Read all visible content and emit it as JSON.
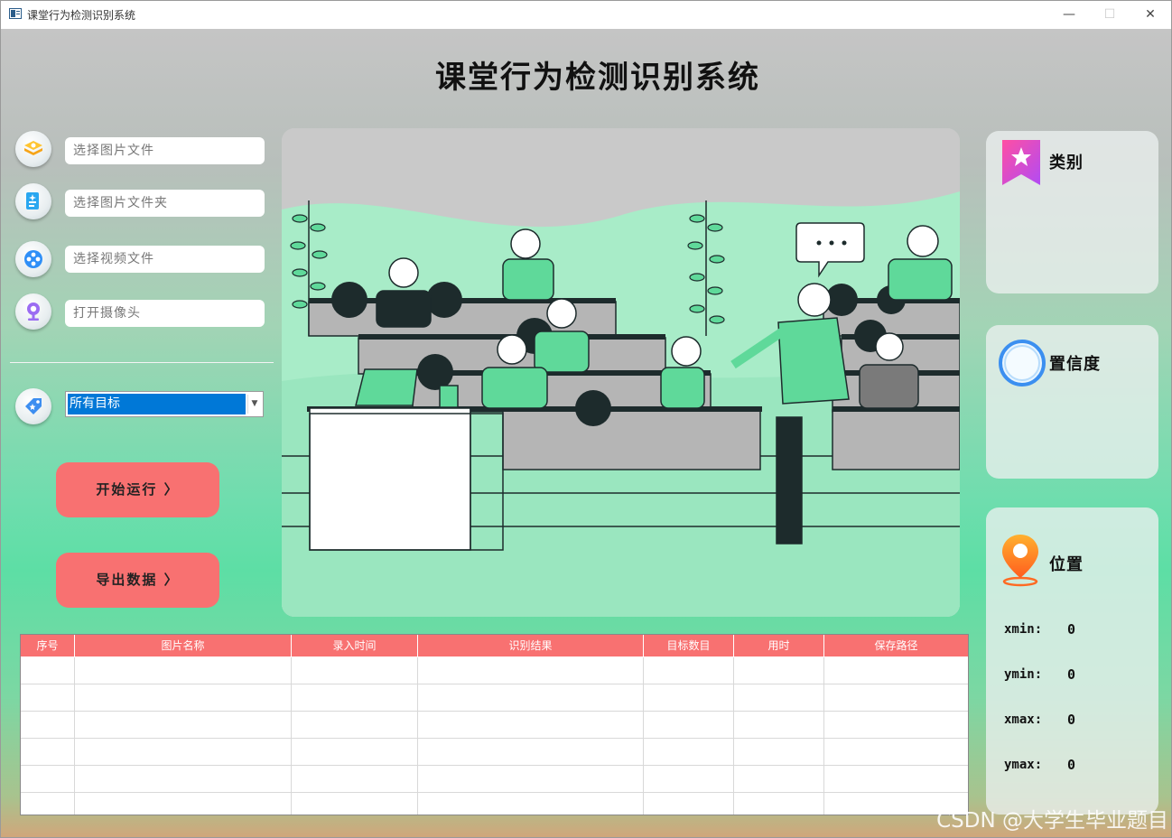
{
  "window": {
    "title": "课堂行为检测识别系统",
    "min": "—",
    "max": "☐",
    "close": "✕"
  },
  "app": {
    "title": "课堂行为检测识别系统"
  },
  "controls": [
    {
      "icon": "image-file-icon",
      "placeholder": "选择图片文件"
    },
    {
      "icon": "image-folder-icon",
      "placeholder": "选择图片文件夹"
    },
    {
      "icon": "video-file-icon",
      "placeholder": "选择视频文件"
    },
    {
      "icon": "camera-icon",
      "placeholder": "打开摄像头"
    }
  ],
  "target_select": {
    "value": "所有目标"
  },
  "buttons": {
    "start": "开始运行 〉",
    "export": "导出数据 〉"
  },
  "cards": {
    "category": {
      "label": "类别"
    },
    "confidence": {
      "label": "置信度"
    },
    "position": {
      "label": "位置"
    }
  },
  "coords": [
    {
      "label": "xmin:",
      "value": "0"
    },
    {
      "label": "ymin:",
      "value": "0"
    },
    {
      "label": "xmax:",
      "value": "0"
    },
    {
      "label": "ymax:",
      "value": "0"
    }
  ],
  "table": {
    "headers": [
      "序号",
      "图片名称",
      "录入时间",
      "识别结果",
      "目标数目",
      "用时",
      "保存路径"
    ]
  },
  "watermark": "CSDN @大学生毕业题目",
  "colors": {
    "accent": "#f87171",
    "selection": "#0078d7",
    "illustration_green": "#5fd99a"
  }
}
